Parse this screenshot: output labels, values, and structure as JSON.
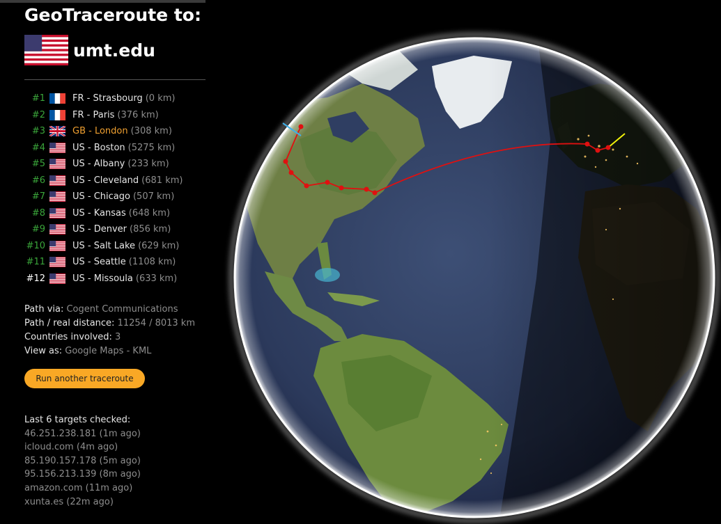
{
  "header": {
    "title": "GeoTraceroute to:",
    "target_host": "umt.edu",
    "target_flag": "US"
  },
  "hops": [
    {
      "num": "#1",
      "flag": "FR",
      "location": "FR - Strasbourg",
      "distance": "(0 km)",
      "state": "normal"
    },
    {
      "num": "#2",
      "flag": "FR",
      "location": "FR - Paris",
      "distance": "(376 km)",
      "state": "normal"
    },
    {
      "num": "#3",
      "flag": "GB",
      "location": "GB - London",
      "distance": "(308 km)",
      "state": "highlight"
    },
    {
      "num": "#4",
      "flag": "US",
      "location": "US - Boston",
      "distance": "(5275 km)",
      "state": "normal"
    },
    {
      "num": "#5",
      "flag": "US",
      "location": "US - Albany",
      "distance": "(233 km)",
      "state": "normal"
    },
    {
      "num": "#6",
      "flag": "US",
      "location": "US - Cleveland",
      "distance": "(681 km)",
      "state": "normal"
    },
    {
      "num": "#7",
      "flag": "US",
      "location": "US - Chicago",
      "distance": "(507 km)",
      "state": "normal"
    },
    {
      "num": "#8",
      "flag": "US",
      "location": "US - Kansas",
      "distance": "(648 km)",
      "state": "normal"
    },
    {
      "num": "#9",
      "flag": "US",
      "location": "US - Denver",
      "distance": "(856 km)",
      "state": "normal"
    },
    {
      "num": "#10",
      "flag": "US",
      "location": "US - Salt Lake",
      "distance": "(629 km)",
      "state": "normal"
    },
    {
      "num": "#11",
      "flag": "US",
      "location": "US - Seattle",
      "distance": "(1108 km)",
      "state": "normal"
    },
    {
      "num": "#12",
      "flag": "US",
      "location": "US - Missoula",
      "distance": "(633 km)",
      "state": "current"
    }
  ],
  "summary": {
    "path_via_label": "Path via:",
    "path_via_value": "Cogent Communications",
    "distance_label": "Path / real distance:",
    "distance_value": "11254 / 8013 km",
    "countries_label": "Countries involved:",
    "countries_value": "3",
    "view_as_label": "View as:",
    "view_google": "Google Maps",
    "view_sep": "-",
    "view_kml": "KML"
  },
  "button": {
    "label": "Run another traceroute"
  },
  "recent": {
    "heading": "Last 6 targets checked:",
    "items": [
      "46.251.238.181 (1m ago)",
      "icloud.com (4m ago)",
      "85.190.157.178 (5m ago)",
      "95.156.213.139 (8m ago)",
      "amazon.com (11m ago)",
      "xunta.es (22m ago)"
    ]
  },
  "colors": {
    "hop_number": "#3aa53a",
    "highlight": "#f0a030",
    "button": "#f9a825",
    "route": "#e01010",
    "start_marker": "#f2f20a",
    "end_marker": "#40b0e8"
  }
}
